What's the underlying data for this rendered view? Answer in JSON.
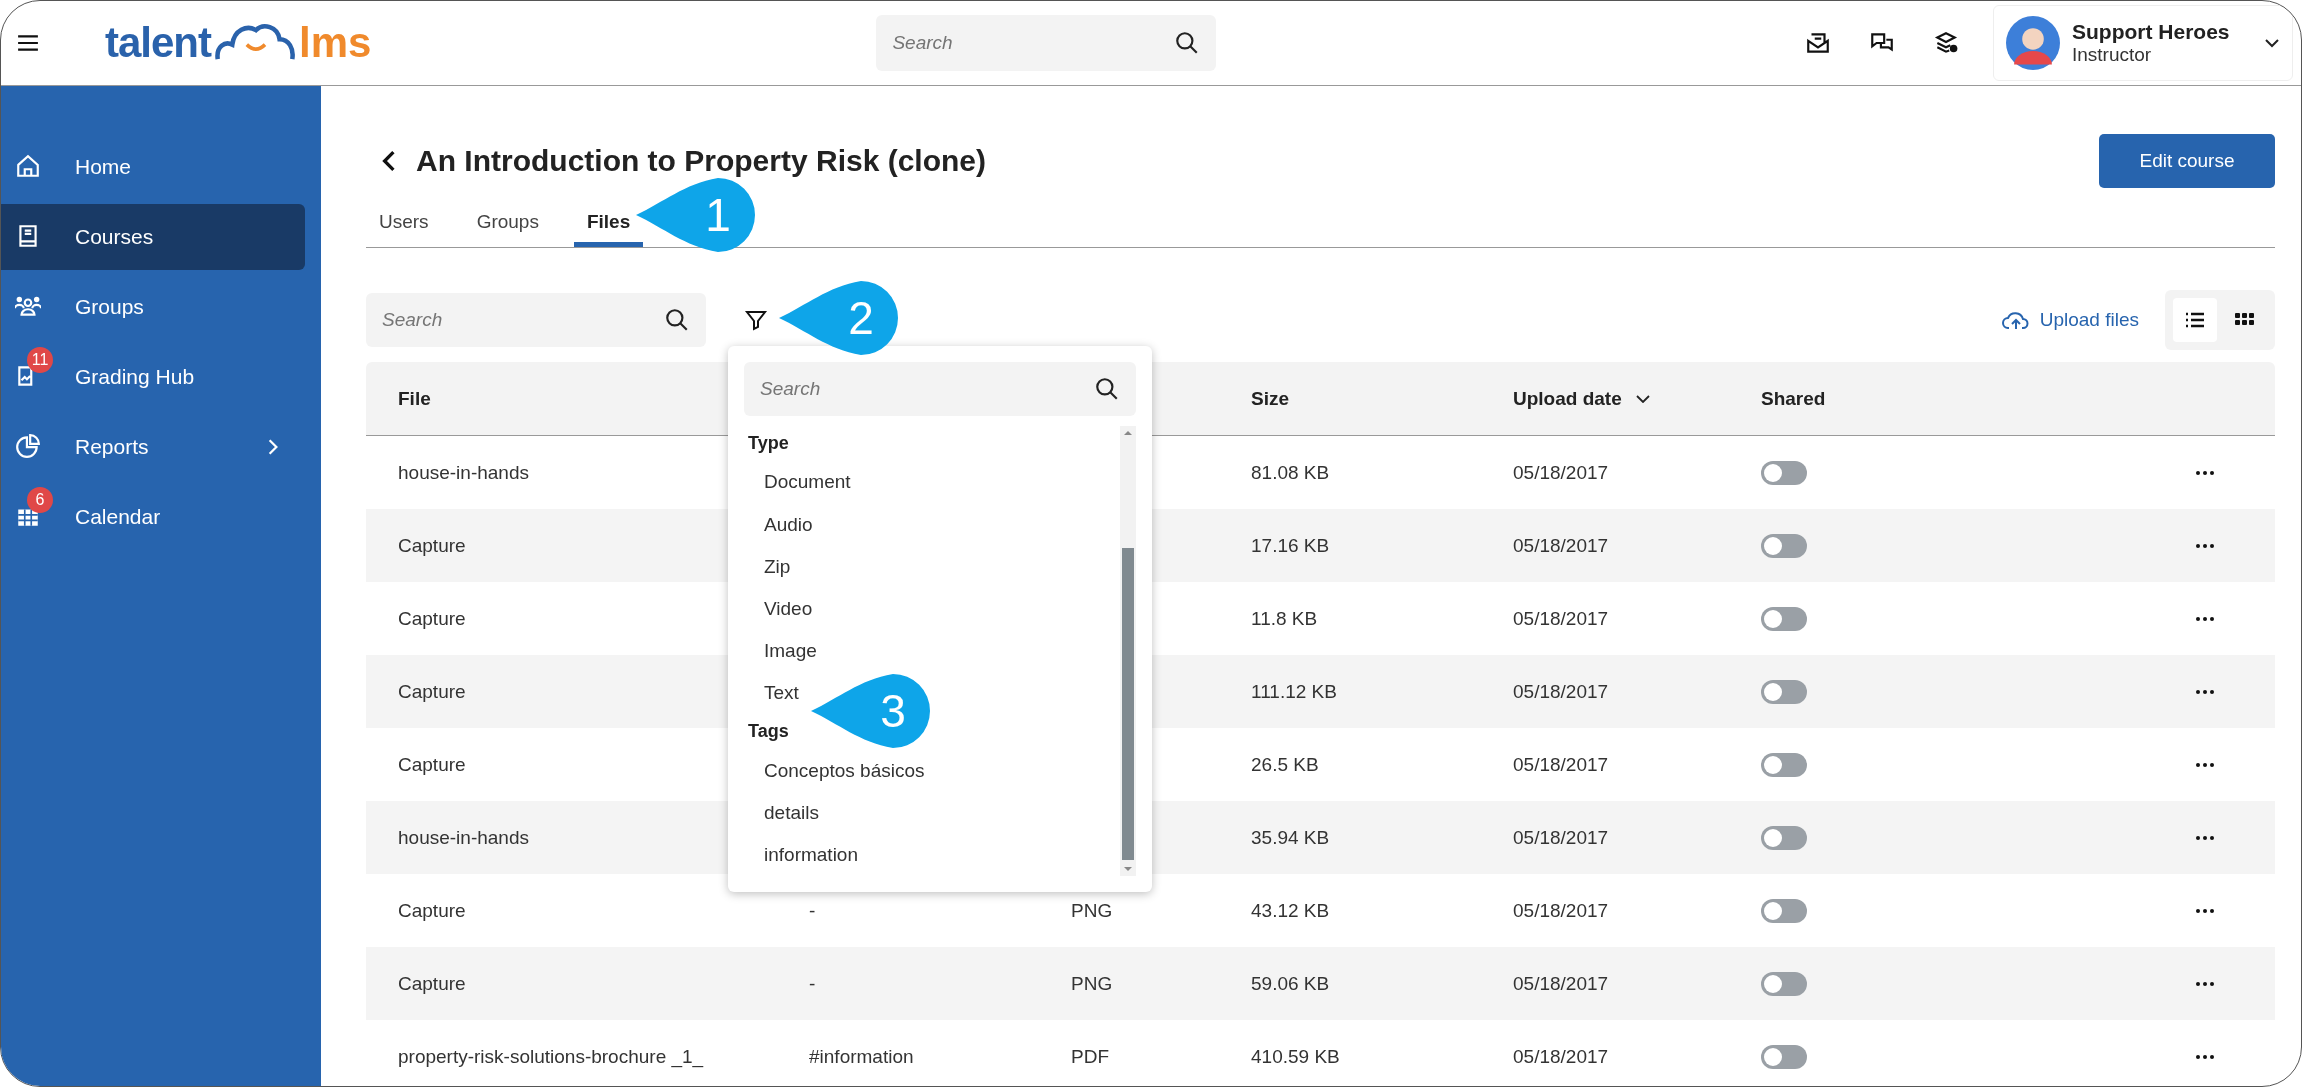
{
  "topbar": {
    "logo": {
      "left": "talent",
      "right": "lms"
    },
    "search": {
      "placeholder": "Search"
    },
    "user": {
      "name": "Support Heroes",
      "role": "Instructor"
    }
  },
  "sidebar": {
    "items": [
      {
        "label": "Home",
        "selected": false
      },
      {
        "label": "Courses",
        "selected": true
      },
      {
        "label": "Groups",
        "selected": false
      },
      {
        "label": "Grading Hub",
        "selected": false,
        "badge": "11"
      },
      {
        "label": "Reports",
        "selected": false,
        "submenu": true
      },
      {
        "label": "Calendar",
        "selected": false,
        "badge": "6"
      }
    ]
  },
  "page": {
    "title": "An Introduction to Property Risk (clone)",
    "edit_button": "Edit course",
    "tabs": [
      {
        "label": "Users",
        "selected": false
      },
      {
        "label": "Groups",
        "selected": false
      },
      {
        "label": "Files",
        "selected": true
      }
    ],
    "search": {
      "placeholder": "Search"
    },
    "upload": "Upload files",
    "views": [
      {
        "kind": "list",
        "selected": true
      },
      {
        "kind": "grid",
        "selected": false
      }
    ]
  },
  "filter_dropdown": {
    "search": {
      "placeholder": "Search"
    },
    "groups": [
      {
        "title": "Type",
        "options": [
          "Document",
          "Audio",
          "Zip",
          "Video",
          "Image",
          "Text"
        ]
      },
      {
        "title": "Tags",
        "options": [
          "Conceptos básicos",
          "details",
          "information"
        ]
      }
    ]
  },
  "table": {
    "columns": [
      {
        "label": "File",
        "sorted": false
      },
      {
        "label": "Size",
        "sorted": false
      },
      {
        "label": "Upload date",
        "sorted": true
      },
      {
        "label": "Shared",
        "sorted": false
      }
    ],
    "rows": [
      {
        "file": "house-in-hands",
        "size": "81.08 KB",
        "date": "05/18/2017",
        "shared": false
      },
      {
        "file": "Capture",
        "size": "17.16 KB",
        "date": "05/18/2017",
        "shared": false
      },
      {
        "file": "Capture",
        "size": "11.8 KB",
        "date": "05/18/2017",
        "shared": false
      },
      {
        "file": "Capture",
        "size": "111.12 KB",
        "date": "05/18/2017",
        "shared": false
      },
      {
        "file": "Capture",
        "size": "26.5 KB",
        "date": "05/18/2017",
        "shared": false
      },
      {
        "file": "house-in-hands",
        "size": "35.94 KB",
        "date": "05/18/2017",
        "shared": false
      },
      {
        "file": "Capture",
        "column_2": "-",
        "column_3": "PNG",
        "size": "43.12 KB",
        "date": "05/18/2017",
        "shared": false
      },
      {
        "file": "Capture",
        "column_2": "-",
        "column_3": "PNG",
        "size": "59.06 KB",
        "date": "05/18/2017",
        "shared": false
      },
      {
        "file": "property-risk-solutions-brochure _1_",
        "column_2": "#information",
        "column_3": "PDF",
        "size": "410.59 KB",
        "date": "05/18/2017",
        "shared": false
      }
    ]
  },
  "callouts": [
    {
      "label": "1"
    },
    {
      "label": "2"
    },
    {
      "label": "3"
    }
  ]
}
